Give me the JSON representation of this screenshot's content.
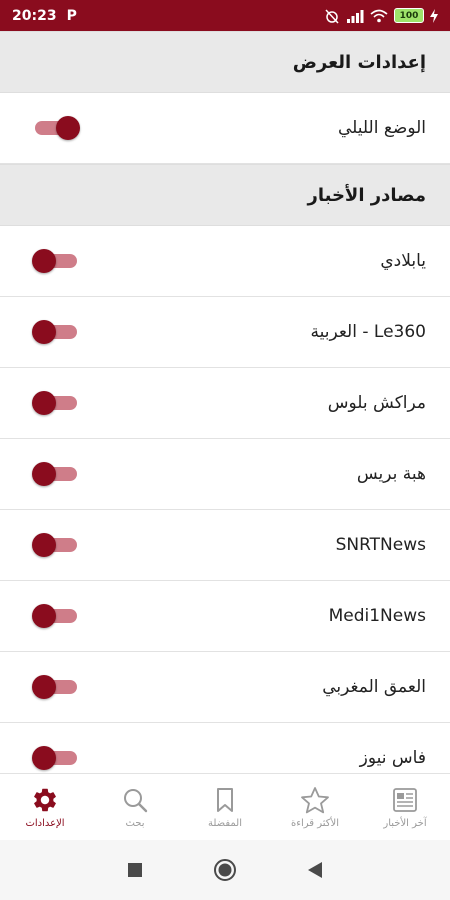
{
  "status_bar": {
    "time": "20:23",
    "battery": "100"
  },
  "display_settings": {
    "title": "إعدادات العرض",
    "night_mode": {
      "label": "الوضع الليلي",
      "enabled": true
    }
  },
  "news_sources": {
    "title": "مصادر الأخبار",
    "items": [
      {
        "label": "يابلادي",
        "enabled": false
      },
      {
        "label": "Le360 - العربية",
        "enabled": false
      },
      {
        "label": "مراكش بلوس",
        "enabled": false
      },
      {
        "label": "هبة بريس",
        "enabled": false
      },
      {
        "label": "SNRTNews",
        "enabled": false
      },
      {
        "label": "Medi1News",
        "enabled": false
      },
      {
        "label": "العمق المغربي",
        "enabled": false
      },
      {
        "label": "فاس نيوز",
        "enabled": false
      }
    ]
  },
  "bottom_nav": {
    "items": [
      {
        "label": "الإعدادات",
        "icon": "gear-icon",
        "active": true
      },
      {
        "label": "بحث",
        "icon": "search-icon",
        "active": false
      },
      {
        "label": "المفضلة",
        "icon": "bookmark-icon",
        "active": false
      },
      {
        "label": "الأكثر قراءة",
        "icon": "star-icon",
        "active": false
      },
      {
        "label": "آخر الأخبار",
        "icon": "newspaper-icon",
        "active": false
      }
    ]
  },
  "colors": {
    "primary": "#8a0c1e",
    "toggle_track": "#cf7d89",
    "section_bg": "#e9e9e9",
    "inactive": "#9a9a9a"
  }
}
